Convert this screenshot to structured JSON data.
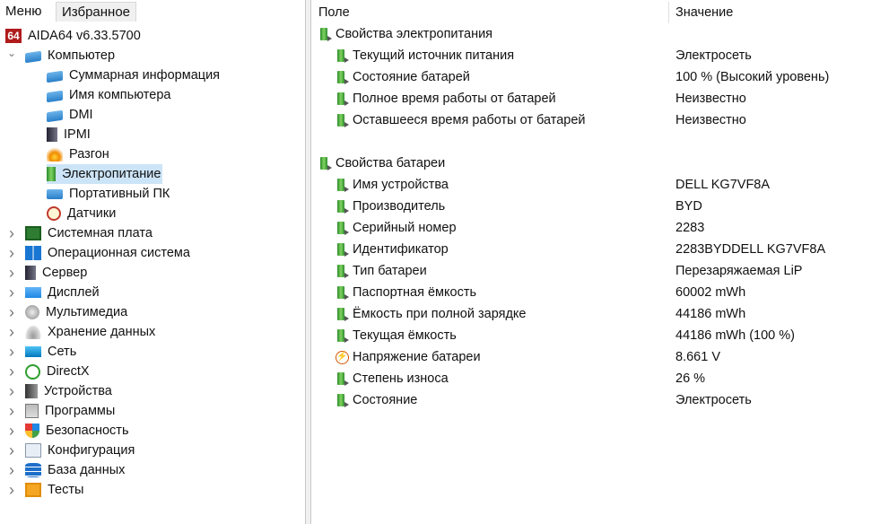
{
  "tabs": {
    "menu": "Меню",
    "favorites": "Избранное"
  },
  "tree": [
    {
      "label": "AIDA64 v6.33.5700",
      "level": 0,
      "icon": "aida64-logo-icon",
      "chev": "",
      "iconText": "64"
    },
    {
      "label": "Компьютер",
      "level": 1,
      "icon": "computer-icon",
      "chev": "down"
    },
    {
      "label": "Суммарная информация",
      "level": 2,
      "icon": "computer-icon"
    },
    {
      "label": "Имя компьютера",
      "level": 2,
      "icon": "computer-icon"
    },
    {
      "label": "DMI",
      "level": 2,
      "icon": "computer-icon"
    },
    {
      "label": "IPMI",
      "level": 2,
      "icon": "server-icon"
    },
    {
      "label": "Разгон",
      "level": 2,
      "icon": "flame-icon"
    },
    {
      "label": "Электропитание",
      "level": 2,
      "icon": "battery-icon",
      "selected": true
    },
    {
      "label": "Портативный ПК",
      "level": 2,
      "icon": "laptop-icon"
    },
    {
      "label": "Датчики",
      "level": 2,
      "icon": "gauge-icon"
    },
    {
      "label": "Системная плата",
      "level": 1,
      "icon": "motherboard-icon",
      "chev": "right"
    },
    {
      "label": "Операционная система",
      "level": 1,
      "icon": "windows-icon",
      "chev": "right"
    },
    {
      "label": "Сервер",
      "level": 1,
      "icon": "server-icon",
      "chev": "right"
    },
    {
      "label": "Дисплей",
      "level": 1,
      "icon": "monitor-icon",
      "chev": "right"
    },
    {
      "label": "Мультимедиа",
      "level": 1,
      "icon": "speaker-icon",
      "chev": "right"
    },
    {
      "label": "Хранение данных",
      "level": 1,
      "icon": "disk-icon",
      "chev": "right"
    },
    {
      "label": "Сеть",
      "level": 1,
      "icon": "network-icon",
      "chev": "right"
    },
    {
      "label": "DirectX",
      "level": 1,
      "icon": "xbox-icon",
      "chev": "right"
    },
    {
      "label": "Устройства",
      "level": 1,
      "icon": "devices-icon",
      "chev": "right"
    },
    {
      "label": "Программы",
      "level": 1,
      "icon": "programs-icon",
      "chev": "right"
    },
    {
      "label": "Безопасность",
      "level": 1,
      "icon": "shield-icon",
      "chev": "right"
    },
    {
      "label": "Конфигурация",
      "level": 1,
      "icon": "config-icon",
      "chev": "right"
    },
    {
      "label": "База данных",
      "level": 1,
      "icon": "database-icon",
      "chev": "right"
    },
    {
      "label": "Тесты",
      "level": 1,
      "icon": "benchmark-icon",
      "chev": "right"
    }
  ],
  "columns": {
    "field": "Поле",
    "value": "Значение"
  },
  "rows": [
    {
      "field": "Свойства электропитания",
      "value": "",
      "group": true
    },
    {
      "field": "Текущий источник питания",
      "value": "Электросеть"
    },
    {
      "field": "Состояние батарей",
      "value": "100 % (Высокий уровень)"
    },
    {
      "field": "Полное время работы от батарей",
      "value": "Неизвестно"
    },
    {
      "field": "Оставшееся время работы от батарей",
      "value": "Неизвестно"
    },
    {
      "spacer": true
    },
    {
      "field": "Свойства батареи",
      "value": "",
      "group": true
    },
    {
      "field": "Имя устройства",
      "value": "DELL KG7VF8A"
    },
    {
      "field": "Производитель",
      "value": "BYD"
    },
    {
      "field": "Серийный номер",
      "value": "2283"
    },
    {
      "field": "Идентификатор",
      "value": "2283BYDDELL KG7VF8A"
    },
    {
      "field": "Тип батареи",
      "value": "Перезаряжаемая LiP"
    },
    {
      "field": "Паспортная ёмкость",
      "value": "60002 mWh"
    },
    {
      "field": "Ёмкость при полной зарядке",
      "value": "44186 mWh"
    },
    {
      "field": "Текущая ёмкость",
      "value": "44186 mWh  (100 %)"
    },
    {
      "field": "Напряжение батареи",
      "value": "8.661 V",
      "icon": "voltage"
    },
    {
      "field": "Степень износа",
      "value": "26 %"
    },
    {
      "field": "Состояние",
      "value": "Электросеть"
    }
  ]
}
